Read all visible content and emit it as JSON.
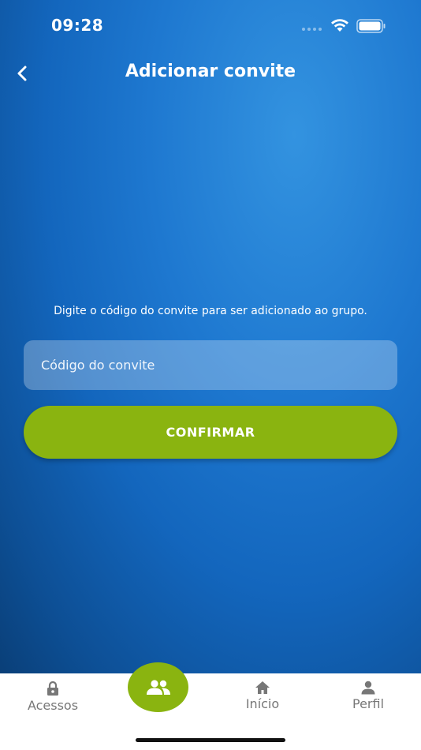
{
  "status_bar": {
    "time": "09:28"
  },
  "header": {
    "title": "Adicionar convite"
  },
  "main": {
    "instruction": "Digite o código do convite para ser adicionado ao grupo.",
    "invite_code": {
      "placeholder": "Código do convite",
      "value": ""
    },
    "confirm_label": "CONFIRMAR"
  },
  "tabbar": {
    "items": [
      {
        "label": "Acessos",
        "icon": "lock-icon"
      },
      {
        "label": "",
        "icon": "group-icon",
        "active": true
      },
      {
        "label": "Início",
        "icon": "home-icon"
      },
      {
        "label": "Perfil",
        "icon": "person-icon"
      }
    ]
  },
  "colors": {
    "accent": "#8ab410",
    "background": "#1e78d0",
    "tab_text": "#777777"
  }
}
